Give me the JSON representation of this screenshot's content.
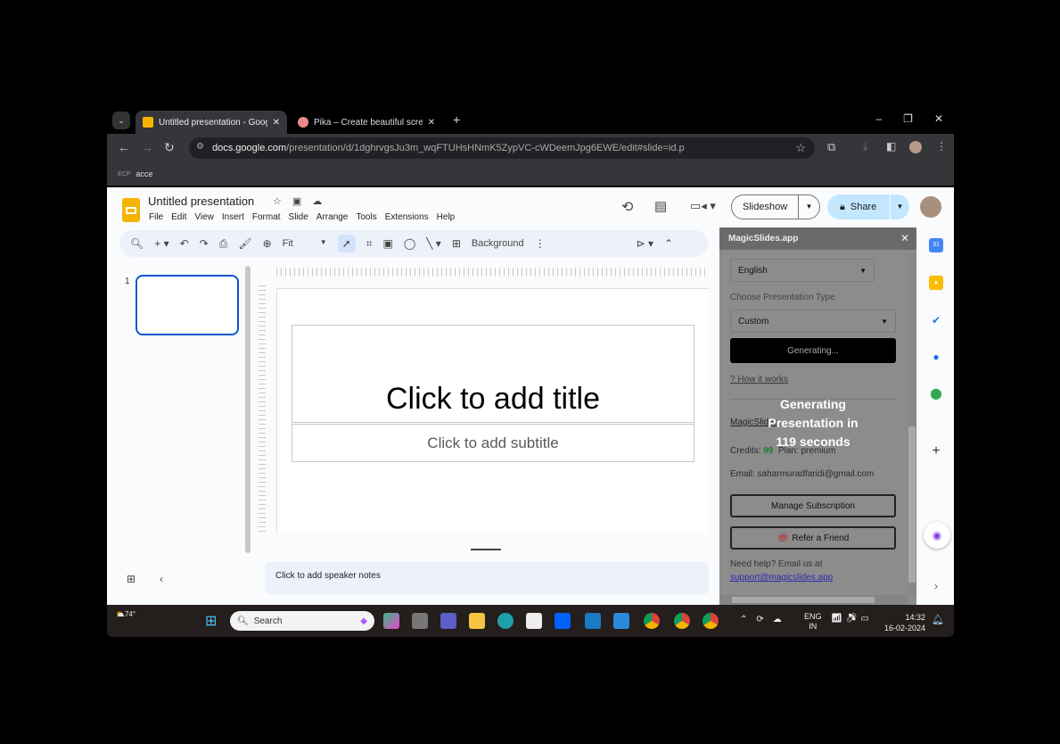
{
  "browser": {
    "tabs": [
      {
        "label": "Untitled presentation - Google S",
        "active": true
      },
      {
        "label": "Pika – Create beautiful screensh",
        "active": false
      }
    ],
    "url_host": "docs.google.com",
    "url_path": "/presentation/d/1dghrvgsJu3m_wqFTUHsHNmK5ZypVC-cWDeemJpg6EWE/edit#slide=id.p",
    "bookmarks": [
      {
        "icon": "ECP",
        "label": "acce"
      }
    ]
  },
  "doc": {
    "title": "Untitled presentation",
    "menu": [
      "File",
      "Edit",
      "View",
      "Insert",
      "Format",
      "Slide",
      "Arrange",
      "Tools",
      "Extensions",
      "Help"
    ],
    "slideshow_label": "Slideshow",
    "share_label": "Share",
    "zoom": "Fit",
    "background_label": "Background",
    "slide_number": "1",
    "title_placeholder": "Click to add title",
    "subtitle_placeholder": "Click to add subtitle",
    "notes_placeholder": "Click to add speaker notes"
  },
  "magicslides": {
    "header": "MagicSlides.app",
    "language": "English",
    "type_label": "Choose Presentation Type",
    "type_value": "Custom",
    "generate_button": "Generating...",
    "how_it_works": "? How it works",
    "account_link": "MagicSlides",
    "credits_label": "Credits:",
    "credits_value": "99",
    "plan_label": "Plan:",
    "plan_value": "premium",
    "email": "Email: saharmuradfaridi@gmail.com",
    "manage_button": "Manage Subscription",
    "refer_button": "Refer a Friend",
    "help_text": "Need help? Email us at",
    "support_email": "support@magicslides.app",
    "overlay_line1": "Generating",
    "overlay_line2": "Presentation in",
    "overlay_line3": "119 seconds",
    "credits_color": "#1e7e34"
  },
  "taskbar": {
    "weather": "74°",
    "search_placeholder": "Search",
    "lang1": "ENG",
    "lang2": "IN",
    "time": "14:32",
    "date": "16-02-2024"
  }
}
